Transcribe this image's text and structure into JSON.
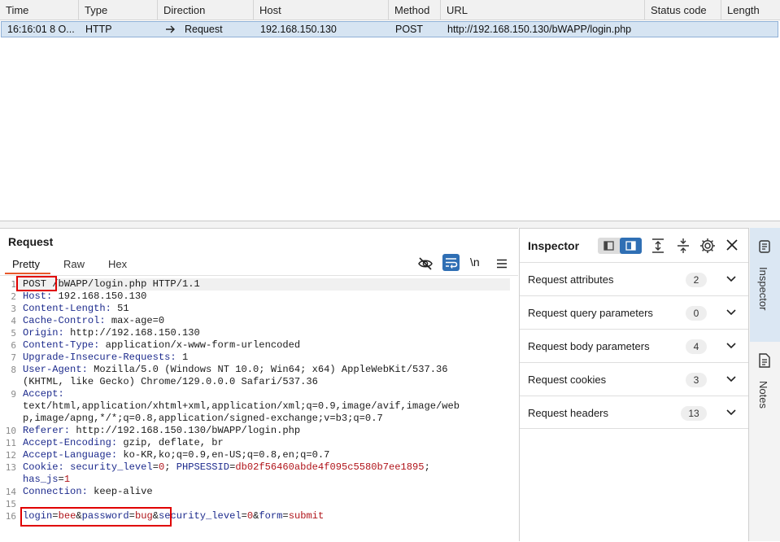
{
  "history": {
    "columns": [
      "Time",
      "Type",
      "Direction",
      "Host",
      "Method",
      "URL",
      "Status code",
      "Length"
    ],
    "rows": [
      {
        "time": "16:16:01 8 O...",
        "type": "HTTP",
        "direction": "Request",
        "host": "192.168.150.130",
        "method": "POST",
        "url": "http://192.168.150.130/bWAPP/login.php",
        "status": "",
        "length": ""
      }
    ]
  },
  "request": {
    "title": "Request",
    "tabs": [
      "Pretty",
      "Raw",
      "Hex"
    ],
    "active_tab": "Pretty",
    "newline_label": "\\n",
    "line_numbers": [
      "1",
      "2",
      "3",
      "4",
      "5",
      "6",
      "7",
      "8",
      "9",
      "10",
      "11",
      "12",
      "13",
      "14",
      "15",
      "16"
    ],
    "lines": {
      "l1_method": "POST",
      "l1_rest": " /bWAPP/login.php HTTP/1.1",
      "l2_key": "Host:",
      "l2_val": " 192.168.150.130",
      "l3_key": "Content-Length:",
      "l3_val": " 51",
      "l4_key": "Cache-Control:",
      "l4_val": " max-age=0",
      "l5_key": "Origin:",
      "l5_val": " http://192.168.150.130",
      "l6_key": "Content-Type:",
      "l6_val": " application/x-www-form-urlencoded",
      "l7_key": "Upgrade-Insecure-Requests:",
      "l7_val": " 1",
      "l8_key": "User-Agent:",
      "l8_val": " Mozilla/5.0 (Windows NT 10.0; Win64; x64) AppleWebKit/537.36",
      "l8_cont": "(KHTML, like Gecko) Chrome/129.0.0.0 Safari/537.36",
      "l9_key": "Accept:",
      "l9_cont1": "text/html,application/xhtml+xml,application/xml;q=0.9,image/avif,image/web",
      "l9_cont2": "p,image/apng,*/*;q=0.8,application/signed-exchange;v=b3;q=0.7",
      "l10_key": "Referer:",
      "l10_val": " http://192.168.150.130/bWAPP/login.php",
      "l11_key": "Accept-Encoding:",
      "l11_val": " gzip, deflate, br",
      "l12_key": "Accept-Language:",
      "l12_val": " ko-KR,ko;q=0.9,en-US;q=0.8,en;q=0.7",
      "l13_key": "Cookie:",
      "l13_c1k": " security_level",
      "l13_eq1": "=",
      "l13_c1v": "0",
      "l13_sep1": "; ",
      "l13_c2k": "PHPSESSID",
      "l13_eq2": "=",
      "l13_c2v": "db02f56460abde4f095c5580b7ee1895",
      "l13_sep2": ";",
      "l13_c3k": "has_js",
      "l13_eq3": "=",
      "l13_c3v": "1",
      "l14_key": "Connection:",
      "l14_val": " keep-alive",
      "l16_p1k": "login",
      "l16_eq1": "=",
      "l16_p1v": "bee",
      "l16_amp1": "&",
      "l16_p2k": "password",
      "l16_eq2": "=",
      "l16_p2v": "bug",
      "l16_amp2": "&",
      "l16_p3k": "security_level",
      "l16_eq3": "=",
      "l16_p3v": "0",
      "l16_amp3": "&",
      "l16_p4k": "form",
      "l16_eq4": "=",
      "l16_p4v": "submit"
    }
  },
  "inspector": {
    "title": "Inspector",
    "sections": [
      {
        "label": "Request attributes",
        "count": "2"
      },
      {
        "label": "Request query parameters",
        "count": "0"
      },
      {
        "label": "Request body parameters",
        "count": "4"
      },
      {
        "label": "Request cookies",
        "count": "3"
      },
      {
        "label": "Request headers",
        "count": "13"
      }
    ]
  },
  "rail": {
    "tabs": [
      {
        "label": "Inspector",
        "icon": "inspector-icon",
        "active": true
      },
      {
        "label": "Notes",
        "icon": "notes-icon",
        "active": false
      }
    ]
  },
  "colors": {
    "selected_row": "#d6e4f2",
    "header_key": "#1d2b8d",
    "param_value": "#b0141a",
    "active_tab_underline": "#e8582b",
    "highlight_box": "#e00000",
    "toggle_active": "#2f6fb4"
  }
}
